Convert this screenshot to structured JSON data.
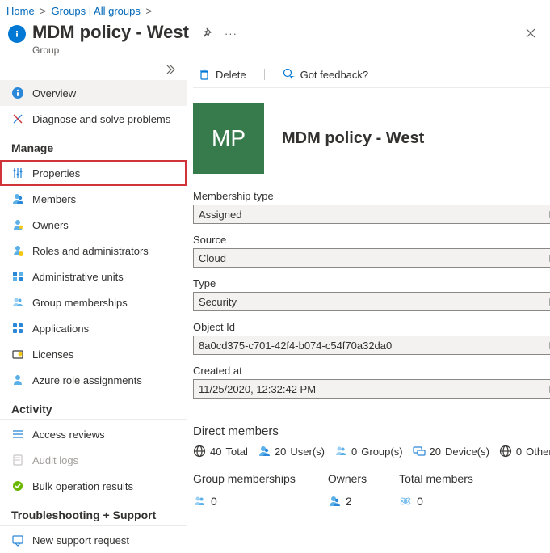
{
  "breadcrumb": {
    "home": "Home",
    "groups": "Groups | All groups"
  },
  "header": {
    "title": "MDM policy - West",
    "subtitle": "Group"
  },
  "sidebar": {
    "top": [
      {
        "label": "Overview",
        "icon": "overview"
      },
      {
        "label": "Diagnose and solve problems",
        "icon": "diagnose"
      }
    ],
    "sections": [
      {
        "title": "Manage",
        "items": [
          {
            "label": "Properties",
            "icon": "properties",
            "selected": true
          },
          {
            "label": "Members",
            "icon": "members"
          },
          {
            "label": "Owners",
            "icon": "owners"
          },
          {
            "label": "Roles and administrators",
            "icon": "roles"
          },
          {
            "label": "Administrative units",
            "icon": "admin-units"
          },
          {
            "label": "Group memberships",
            "icon": "group-memberships"
          },
          {
            "label": "Applications",
            "icon": "apps"
          },
          {
            "label": "Licenses",
            "icon": "licenses"
          },
          {
            "label": "Azure role assignments",
            "icon": "azure-roles"
          }
        ]
      },
      {
        "title": "Activity",
        "items": [
          {
            "label": "Access reviews",
            "icon": "access-reviews"
          },
          {
            "label": "Audit logs",
            "icon": "audit-logs",
            "disabled": true
          },
          {
            "label": "Bulk operation results",
            "icon": "bulk-ops"
          }
        ]
      },
      {
        "title": "Troubleshooting + Support",
        "items": [
          {
            "label": "New support request",
            "icon": "support"
          }
        ]
      }
    ]
  },
  "commands": {
    "delete": "Delete",
    "feedback": "Got feedback?"
  },
  "group": {
    "initials": "MP",
    "name": "MDM policy - West",
    "fields": [
      {
        "label": "Membership type",
        "value": "Assigned"
      },
      {
        "label": "Source",
        "value": "Cloud"
      },
      {
        "label": "Type",
        "value": "Security"
      },
      {
        "label": "Object Id",
        "value": "8a0cd375-c701-42f4-b074-c54f70a32da0"
      },
      {
        "label": "Created at",
        "value": "11/25/2020, 12:32:42 PM"
      }
    ]
  },
  "directMembers": {
    "title": "Direct members",
    "stats": [
      {
        "icon": "globe",
        "count": "40",
        "label": "Total"
      },
      {
        "icon": "user",
        "count": "20",
        "label": "User(s)"
      },
      {
        "icon": "group",
        "count": "0",
        "label": "Group(s)"
      },
      {
        "icon": "device",
        "count": "20",
        "label": "Device(s)"
      },
      {
        "icon": "globe",
        "count": "0",
        "label": "Other(s)"
      }
    ]
  },
  "summaries": [
    {
      "title": "Group memberships",
      "icon": "group",
      "value": "0"
    },
    {
      "title": "Owners",
      "icon": "user",
      "value": "2"
    },
    {
      "title": "Total members",
      "icon": "atom",
      "value": "0"
    }
  ]
}
